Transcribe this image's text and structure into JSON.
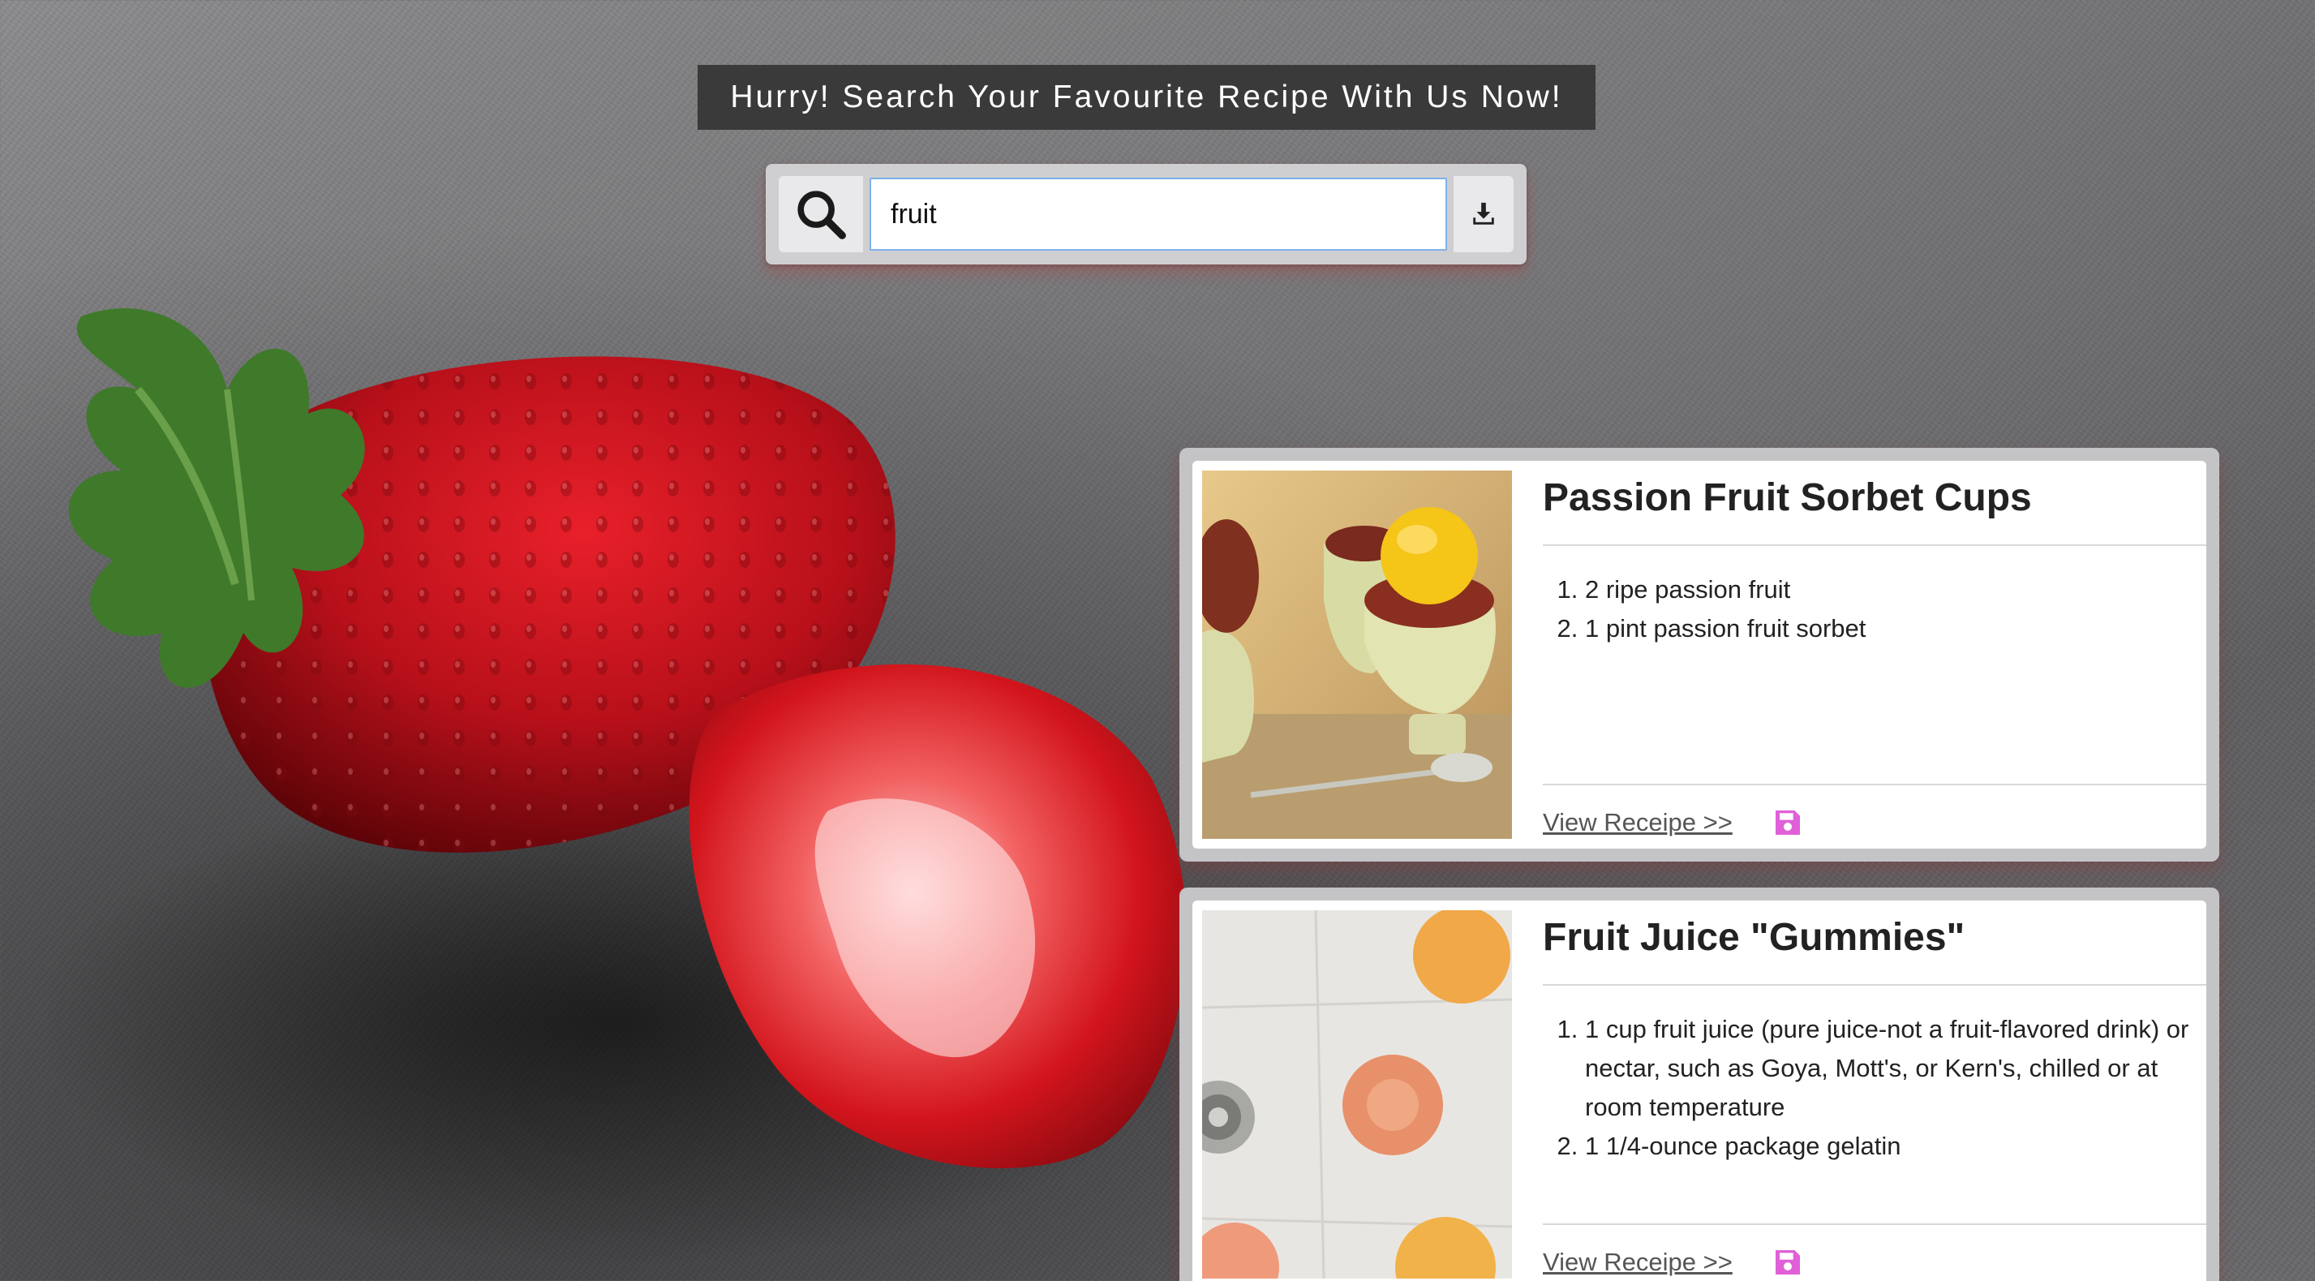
{
  "header": {
    "banner_text": "Hurry! Search Your Favourite Recipe With Us Now!"
  },
  "search": {
    "value": "fruit",
    "search_icon": "search-icon",
    "download_icon": "download-icon"
  },
  "recipes": [
    {
      "title": "Passion Fruit Sorbet Cups",
      "ingredients": [
        "2 ripe passion fruit",
        "1 pint passion fruit sorbet"
      ],
      "link_label": "View Receipe >>",
      "save_icon": "floppy-disk-icon"
    },
    {
      "title": "Fruit Juice \"Gummies\"",
      "ingredients": [
        "1 cup fruit juice (pure juice-not a fruit-flavored drink) or nectar, such as Goya, Mott's, or Kern's, chilled or at room temperature",
        "1 1/4-ounce package gelatin"
      ],
      "link_label": "View Receipe >>",
      "save_icon": "floppy-disk-icon"
    }
  ],
  "colors": {
    "banner_bg": "#3a3a3a",
    "save_icon": "#e060d8",
    "input_border": "#7fb0ea"
  }
}
